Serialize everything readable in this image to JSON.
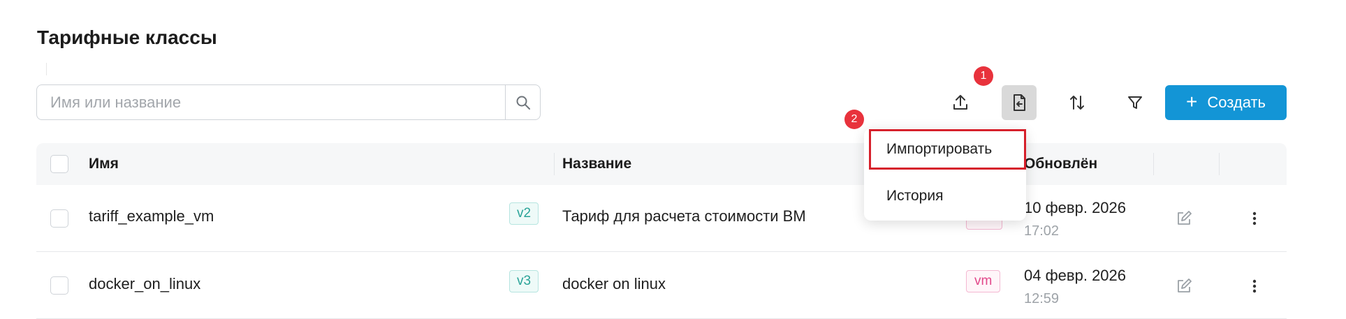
{
  "page": {
    "title": "Тарифные классы"
  },
  "search": {
    "placeholder": "Имя или название"
  },
  "toolbar": {
    "create_label": "Создать"
  },
  "badges": {
    "first": "1",
    "second": "2"
  },
  "menu": {
    "import_label": "Импортировать",
    "history_label": "История"
  },
  "table": {
    "headers": {
      "name": "Имя",
      "title": "Название",
      "updated": "Обновлён"
    },
    "rows": [
      {
        "name": "tariff_example_vm",
        "version": "v2",
        "title": "Тариф для расчета стоимости ВМ",
        "tag": "",
        "date": "10 февр. 2026",
        "time": "17:02"
      },
      {
        "name": "docker_on_linux",
        "version": "v3",
        "title": "docker on linux",
        "tag": "vm",
        "date": "04 февр. 2026",
        "time": "12:59"
      }
    ]
  }
}
